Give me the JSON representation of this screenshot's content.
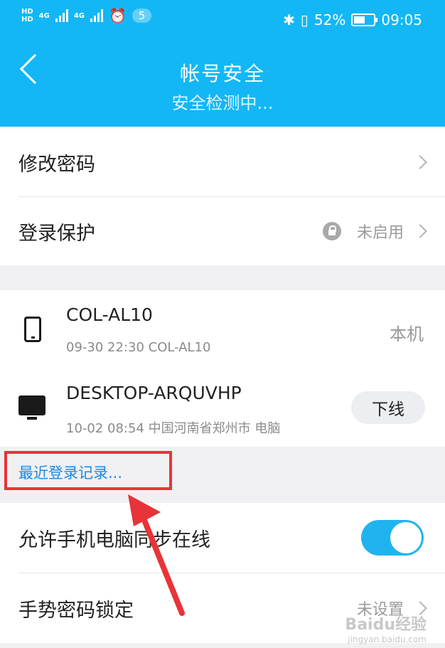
{
  "status_bar": {
    "net1": "HD",
    "net2": "HD",
    "sig1": "4G",
    "sig2": "4G",
    "notif_count": "5",
    "battery": "52%",
    "time": "09:05"
  },
  "header": {
    "title": "帐号安全",
    "scanning": "安全检测中..."
  },
  "settings": {
    "change_password": "修改密码",
    "login_protect": "登录保护",
    "login_protect_value": "未启用"
  },
  "devices": [
    {
      "name": "COL-AL10",
      "meta": "09-30 22:30 COL-AL10",
      "tag": "本机"
    },
    {
      "name": "DESKTOP-ARQUVHP",
      "meta": "10-02 08:54 中国河南省郑州市 电脑",
      "button": "下线"
    }
  ],
  "recent_login": "最近登录记录...",
  "sync": {
    "label": "允许手机电脑同步在线",
    "enabled": true
  },
  "gesture": {
    "label": "手势密码锁定",
    "value": "未设置"
  },
  "watermark": {
    "line1": "Baidu经验",
    "line2": "jingyan.baidu.com"
  },
  "colors": {
    "accent": "#13b7f5",
    "link": "#1a8ae6",
    "annotation": "#e8333a"
  }
}
